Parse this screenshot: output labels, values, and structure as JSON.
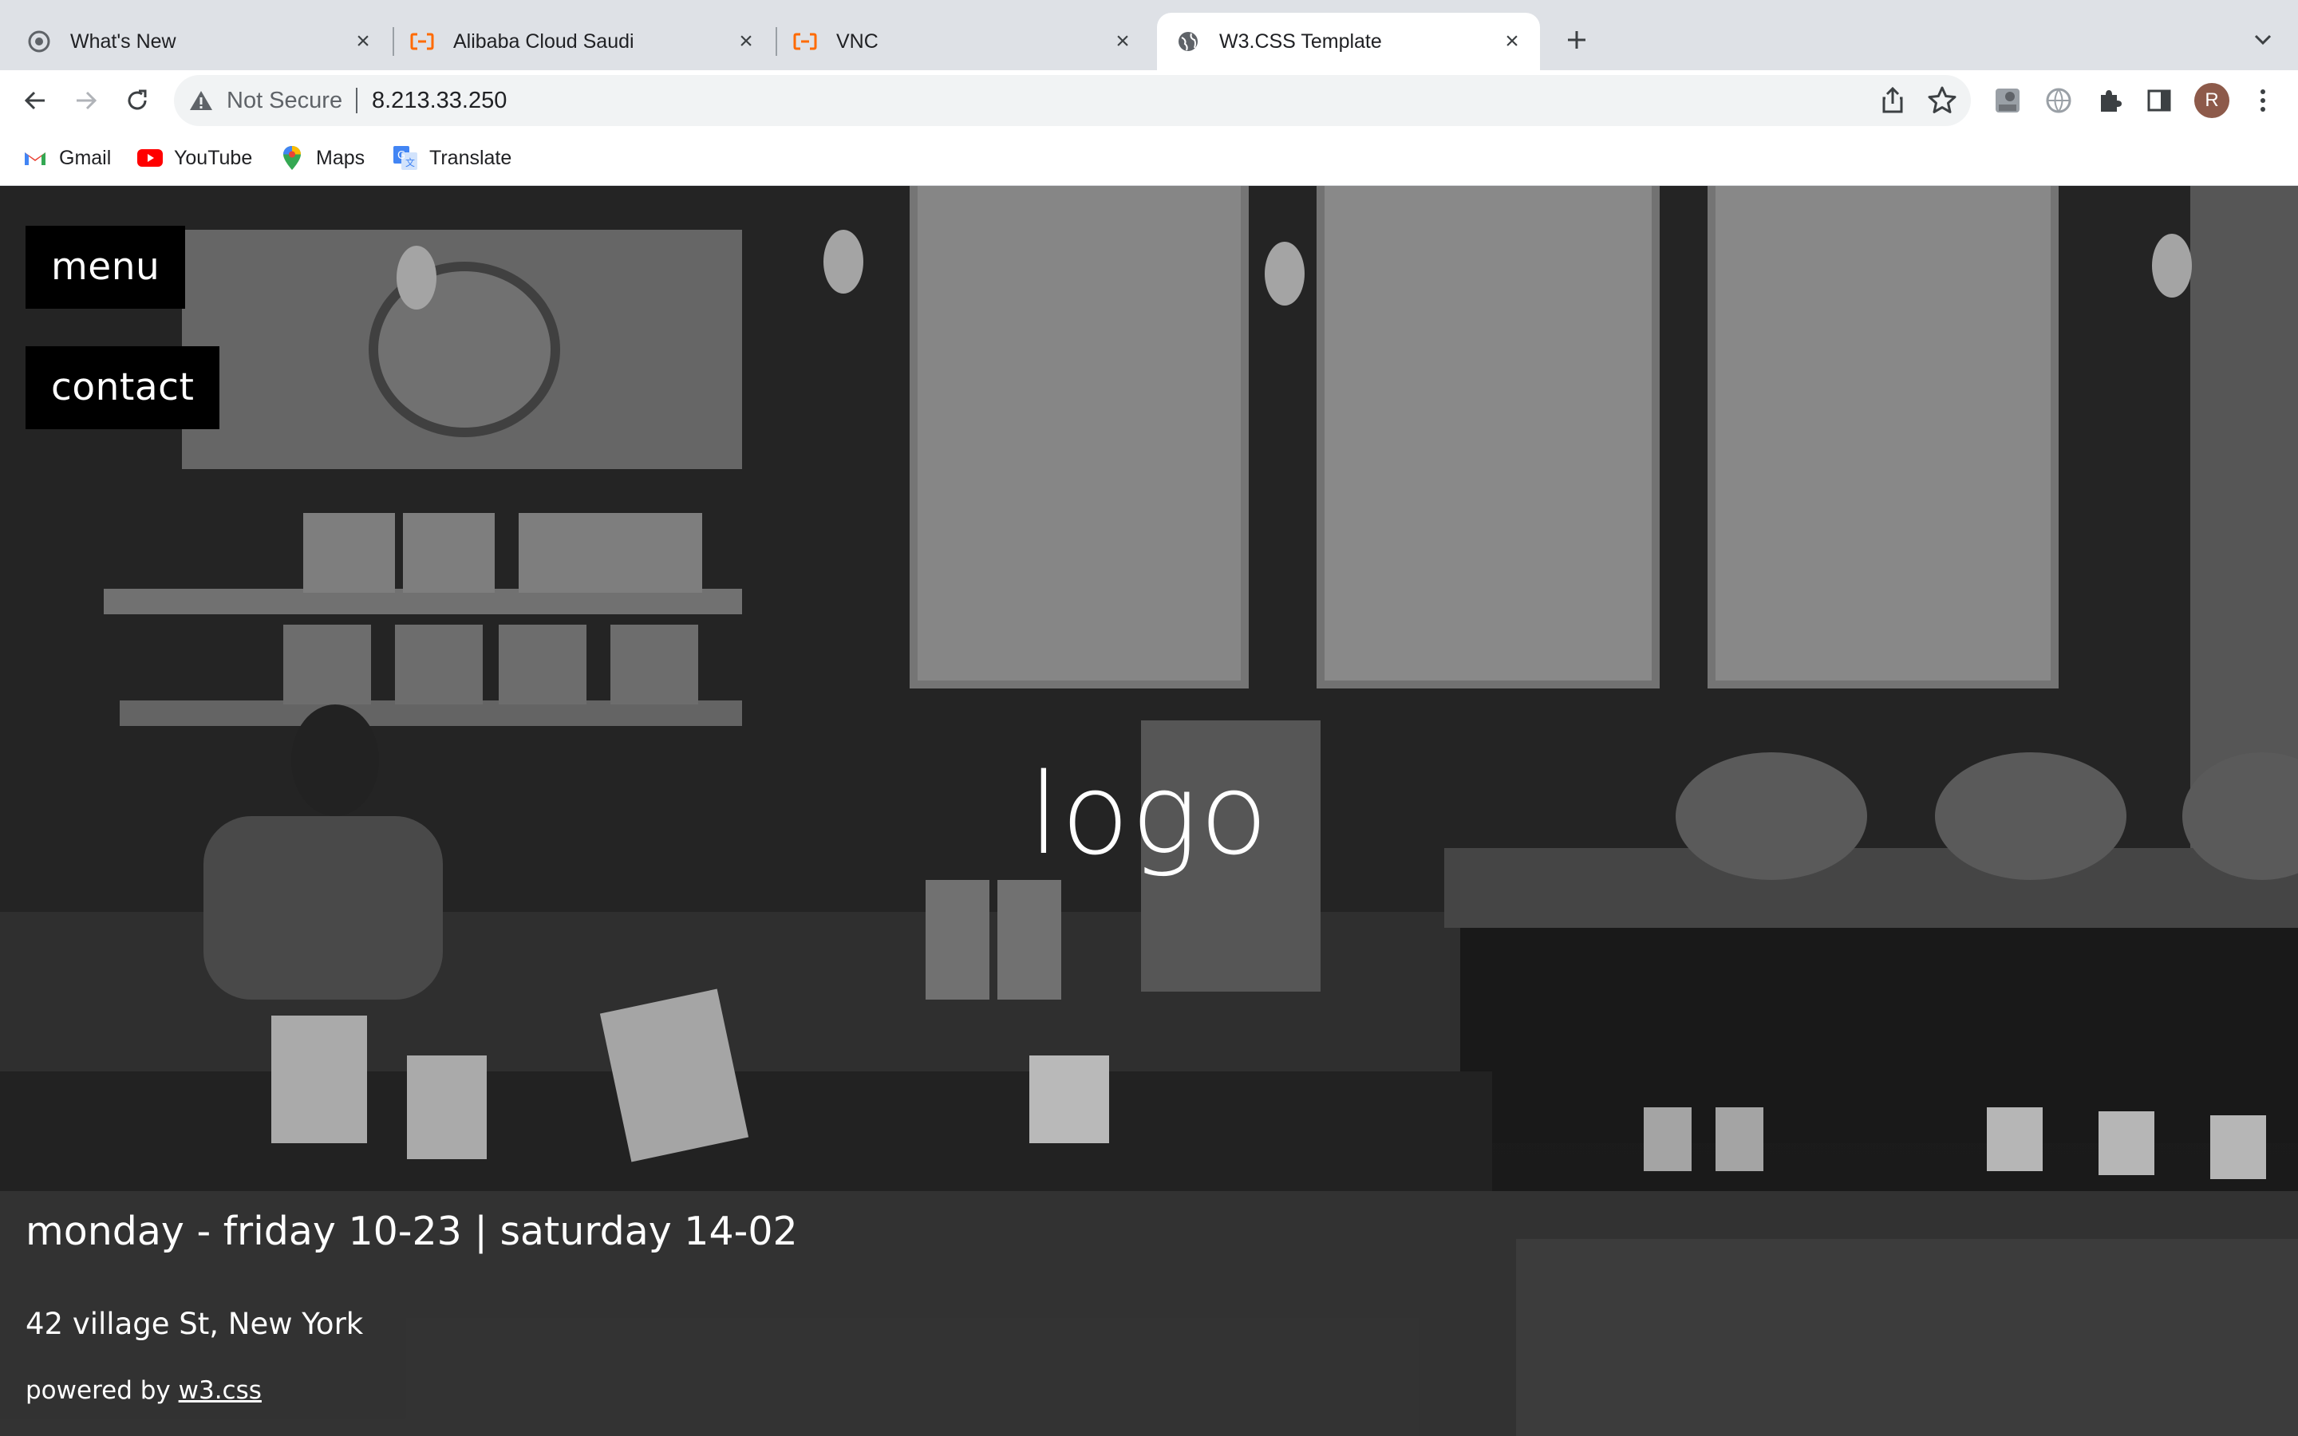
{
  "browser": {
    "tabs": [
      {
        "title": "What's New",
        "icon": "chrome-icon",
        "active": false
      },
      {
        "title": "Alibaba Cloud Saudi",
        "icon": "alibaba-cloud-icon",
        "active": false
      },
      {
        "title": "VNC",
        "icon": "alibaba-cloud-icon",
        "active": false
      },
      {
        "title": "W3.CSS Template",
        "icon": "globe-icon",
        "active": true
      }
    ],
    "omnibox": {
      "security_label": "Not Secure",
      "url": "8.213.33.250"
    },
    "profile_initial": "R",
    "bookmarks": [
      {
        "label": "Gmail",
        "icon": "gmail-icon"
      },
      {
        "label": "YouTube",
        "icon": "youtube-icon"
      },
      {
        "label": "Maps",
        "icon": "maps-icon"
      },
      {
        "label": "Translate",
        "icon": "translate-icon"
      }
    ]
  },
  "page": {
    "nav": {
      "menu_label": "menu",
      "contact_label": "contact"
    },
    "logo_text": "logo",
    "hours": "monday - friday 10-23 | saturday 14-02",
    "address": "42 village St, New York",
    "footer": {
      "powered_prefix": "powered by ",
      "powered_link": "w3.css"
    },
    "background_image": "grayscale coffee shop interior"
  },
  "colors": {
    "tabstrip": "#dee1e6",
    "nav_button_bg": "#000000",
    "page_text": "#ffffff"
  }
}
